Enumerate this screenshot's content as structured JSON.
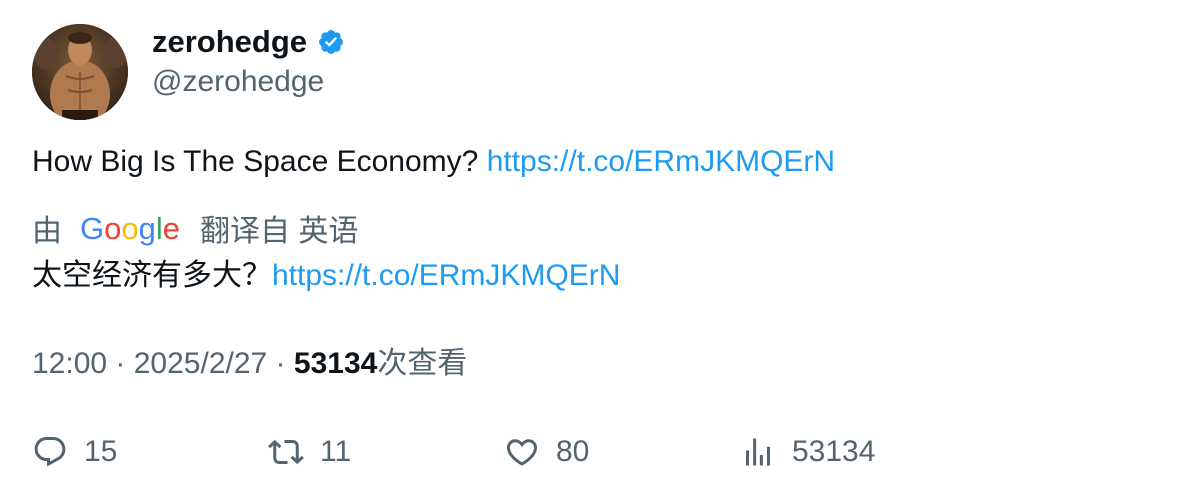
{
  "author": {
    "display_name": "zerohedge",
    "handle": "@zerohedge",
    "verified": true
  },
  "tweet": {
    "text": "How Big Is The Space Economy? ",
    "link": "https://t.co/ERmJKMQErN"
  },
  "translation": {
    "by_label": "由",
    "provider_logo_text": "Google",
    "from_label": "翻译自 英语",
    "text": "太空经济有多大？",
    "link": "https://t.co/ERmJKMQErN"
  },
  "meta": {
    "time": "12:00",
    "separator1": " · ",
    "date": "2025/2/27",
    "separator2": " · ",
    "views_count": "53134",
    "views_label": "次查看"
  },
  "actions": {
    "replies": "15",
    "retweets": "11",
    "likes": "80",
    "views": "53134"
  },
  "colors": {
    "link": "#1d9bf0",
    "secondary_text": "#536471",
    "primary_text": "#0f1419",
    "verified_badge": "#1d9bf0"
  },
  "icons": [
    "verified-badge-icon",
    "reply-icon",
    "retweet-icon",
    "like-icon",
    "views-icon"
  ]
}
